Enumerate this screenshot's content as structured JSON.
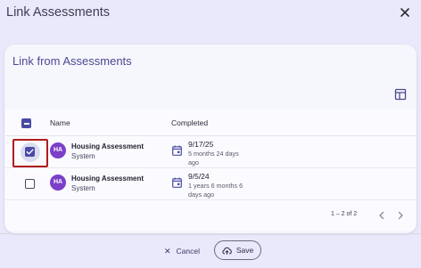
{
  "dialog": {
    "title": "Link Assessments"
  },
  "card": {
    "title": "Link from Assessments"
  },
  "table": {
    "columns": [
      "Name",
      "Completed"
    ],
    "rows": [
      {
        "avatar": "HA",
        "name": "Housing Assessment",
        "source": "System",
        "date": "9/17/25",
        "ago": "5 months 24 days ago",
        "checked": true
      },
      {
        "avatar": "HA",
        "name": "Housing Assessment",
        "source": "System",
        "date": "9/5/24",
        "ago": "1 years 6 months 6 days ago",
        "checked": false
      }
    ],
    "pagination": "1 – 2 of 2"
  },
  "actions": {
    "cancel_label": "Cancel",
    "save_label": "Save"
  },
  "colors": {
    "accent": "#4a4aa6",
    "avatar": "#7b3fc8",
    "highlight": "#b01c1c",
    "background": "#e9e9fb"
  },
  "icons": [
    "close-icon",
    "columns-icon",
    "calendar-icon",
    "chevron-left-icon",
    "chevron-right-icon",
    "cloud-upload-icon"
  ]
}
